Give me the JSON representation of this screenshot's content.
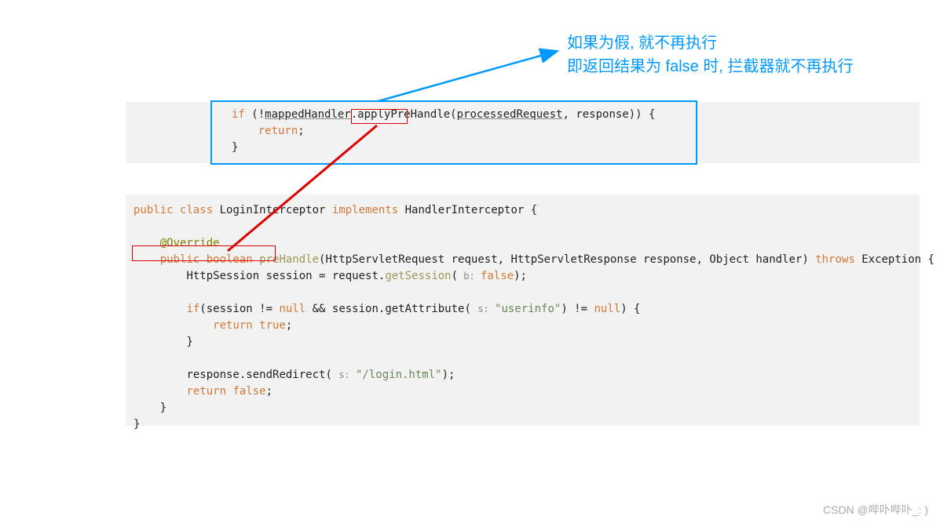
{
  "annotation": {
    "line1": "如果为假, 就不再执行",
    "line2": "即返回结果为 false 时, 拦截器就不再执行"
  },
  "code1": {
    "if": "if",
    "not": "!",
    "mappedHandler": "mappedHandler",
    "dot_apply": ".apply",
    "PreHandle": "PreHandle",
    "lparen": "(",
    "processedRequest": "processedRequest",
    "comma_response": ", response)) {",
    "return": "return",
    "semi": ";",
    "rbrace": "}"
  },
  "code2": {
    "public": "public",
    "class": "class",
    "LoginInterceptor": " LoginInterceptor ",
    "implements": "implements",
    "HandlerInterceptor": " HandlerInterceptor {",
    "Override": "@Override",
    "boolean": "boolean",
    "preHandle": "preHandle",
    "args": "(HttpServletRequest request, HttpServletResponse response, Object handler) ",
    "throws": "throws",
    "exception": " Exception {",
    "sessionLine_a": "HttpSession session = request.",
    "getSession": "getSession",
    "hint_b": " b: ",
    "false_kw": "false",
    "close_paren": ");",
    "if_kw": "if",
    "ifCond_a": "(session != ",
    "null_kw": "null",
    "and": " && session.getAttribute( ",
    "hint_s": "s: ",
    "userinfo": "\"userinfo\"",
    "ifCond_b": ") != ",
    "ifCond_c": ") {",
    "return_kw": "return",
    "true_kw": "true",
    "semi2": ";",
    "rbrace2": "}",
    "sendRedirect_a": "response.sendRedirect( ",
    "loginhtml": "\"/login.html\"",
    "sendRedirect_b": ");",
    "rbrace3": "}",
    "rbrace4": "}"
  },
  "watermark": "CSDN @哔卟哔卟_: )"
}
